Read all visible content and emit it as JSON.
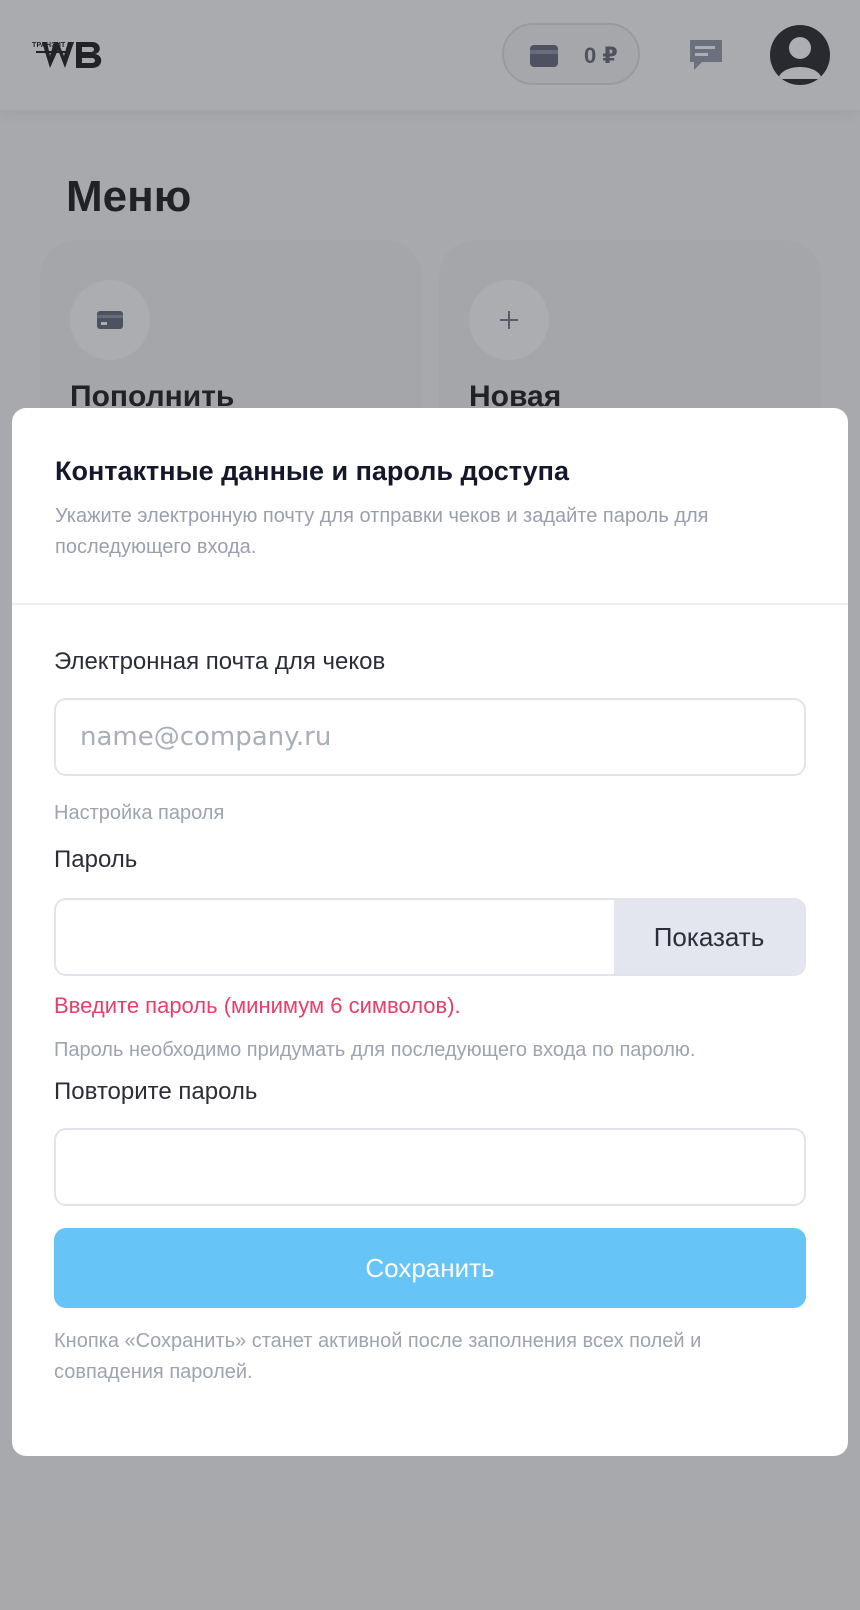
{
  "header": {
    "logo_small_text": "ТРАНЗИТ",
    "logo_text": "WB",
    "balance": "0 ₽"
  },
  "menu": {
    "title": "Меню",
    "cards": [
      {
        "title": "Пополнить",
        "icon": "card-icon"
      },
      {
        "title": "Новая",
        "icon": "plus-icon"
      }
    ]
  },
  "modal": {
    "title": "Контактные данные и пароль доступа",
    "subtitle": "Укажите электронную почту для отправки чеков и задайте пароль для последующего входа.",
    "email_label": "Электронная почта для чеков",
    "email_placeholder": "name@company.ru",
    "email_value": "",
    "password_section": "Настройка пароля",
    "password_label": "Пароль",
    "password_value": "",
    "show_button": "Показать",
    "password_error": "Введите пароль (минимум 6 символов).",
    "password_hint": "Пароль необходимо придумать для последующего входа по паролю.",
    "repeat_label": "Повторите пароль",
    "repeat_value": "",
    "save_button": "Сохранить",
    "footnote": "Кнопка «Сохранить» станет активной после заполнения всех полей и совпадения паролей."
  },
  "colors": {
    "accent_button": "#67c4f7",
    "error": "#ea3d6a",
    "show_button_bg": "#e3e6ee"
  }
}
